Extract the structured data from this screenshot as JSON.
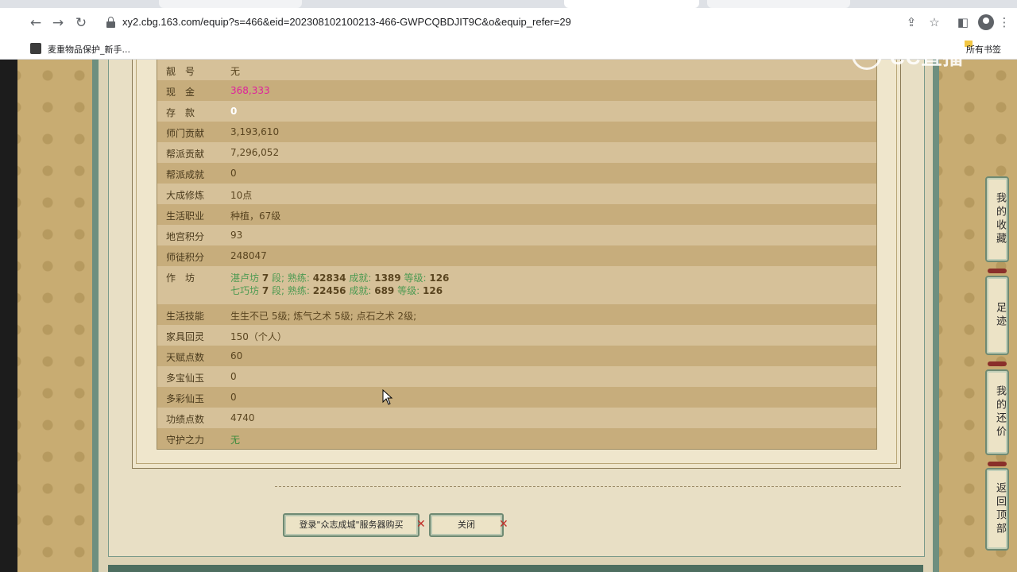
{
  "browser": {
    "url": "xy2.cbg.163.com/equip?s=466&eid=202308102100213-466-GWPCQBDJIT9C&o&equip_refer=29",
    "bookmark_label": "麦重物品保护_新手...",
    "all_bookmarks_label": "所有书签"
  },
  "watermark": {
    "text": "CC直播"
  },
  "info_rows": [
    {
      "label": "靓　号",
      "value": "无",
      "style": "normal"
    },
    {
      "label": "现　金",
      "value": "368,333",
      "style": "pink"
    },
    {
      "label": "存　款",
      "value": "0",
      "style": "white"
    },
    {
      "label": "师门贡献",
      "value": "3,193,610",
      "style": "normal"
    },
    {
      "label": "帮派贡献",
      "value": "7,296,052",
      "style": "normal"
    },
    {
      "label": "帮派成就",
      "value": "0",
      "style": "normal"
    },
    {
      "label": "大成修炼",
      "value": "10点",
      "style": "normal"
    },
    {
      "label": "生活职业",
      "value": "种植，67级",
      "style": "normal"
    },
    {
      "label": "地宫积分",
      "value": "93",
      "style": "normal"
    },
    {
      "label": "师徒积分",
      "value": "248047",
      "style": "normal"
    }
  ],
  "workshop": {
    "label": "作　坊",
    "lines": [
      {
        "name": "湛卢坊",
        "level": "7",
        "seg": "段;",
        "skill_label": "熟练:",
        "skill": "42834",
        "achv_label": "成就:",
        "achv": "1389",
        "grade_label": "等级:",
        "grade": "126"
      },
      {
        "name": "七巧坊",
        "level": "7",
        "seg": "段;",
        "skill_label": "熟练:",
        "skill": "22456",
        "achv_label": "成就:",
        "achv": "689",
        "grade_label": "等级:",
        "grade": "126"
      }
    ]
  },
  "info_rows_2": [
    {
      "label": "生活技能",
      "value": "生生不已 5级; 炼气之术 5级; 点石之术 2级;",
      "style": "normal"
    },
    {
      "label": "家具回灵",
      "value": "150（个人）",
      "style": "normal"
    },
    {
      "label": "天赋点数",
      "value": "60",
      "style": "normal"
    },
    {
      "label": "多宝仙玉",
      "value": "0",
      "style": "normal"
    },
    {
      "label": "多彩仙玉",
      "value": "0",
      "style": "normal"
    },
    {
      "label": "功绩点数",
      "value": "4740",
      "style": "normal"
    },
    {
      "label": "守护之力",
      "value": "无",
      "style": "green"
    }
  ],
  "buttons": {
    "login_buy": "登录\"众志成城\"服务器购买",
    "close": "关闭"
  },
  "side_buttons": {
    "favorites": "我的收藏",
    "footprint": "足迹",
    "my_offers": "我的还价",
    "back_top": "返回顶部"
  }
}
